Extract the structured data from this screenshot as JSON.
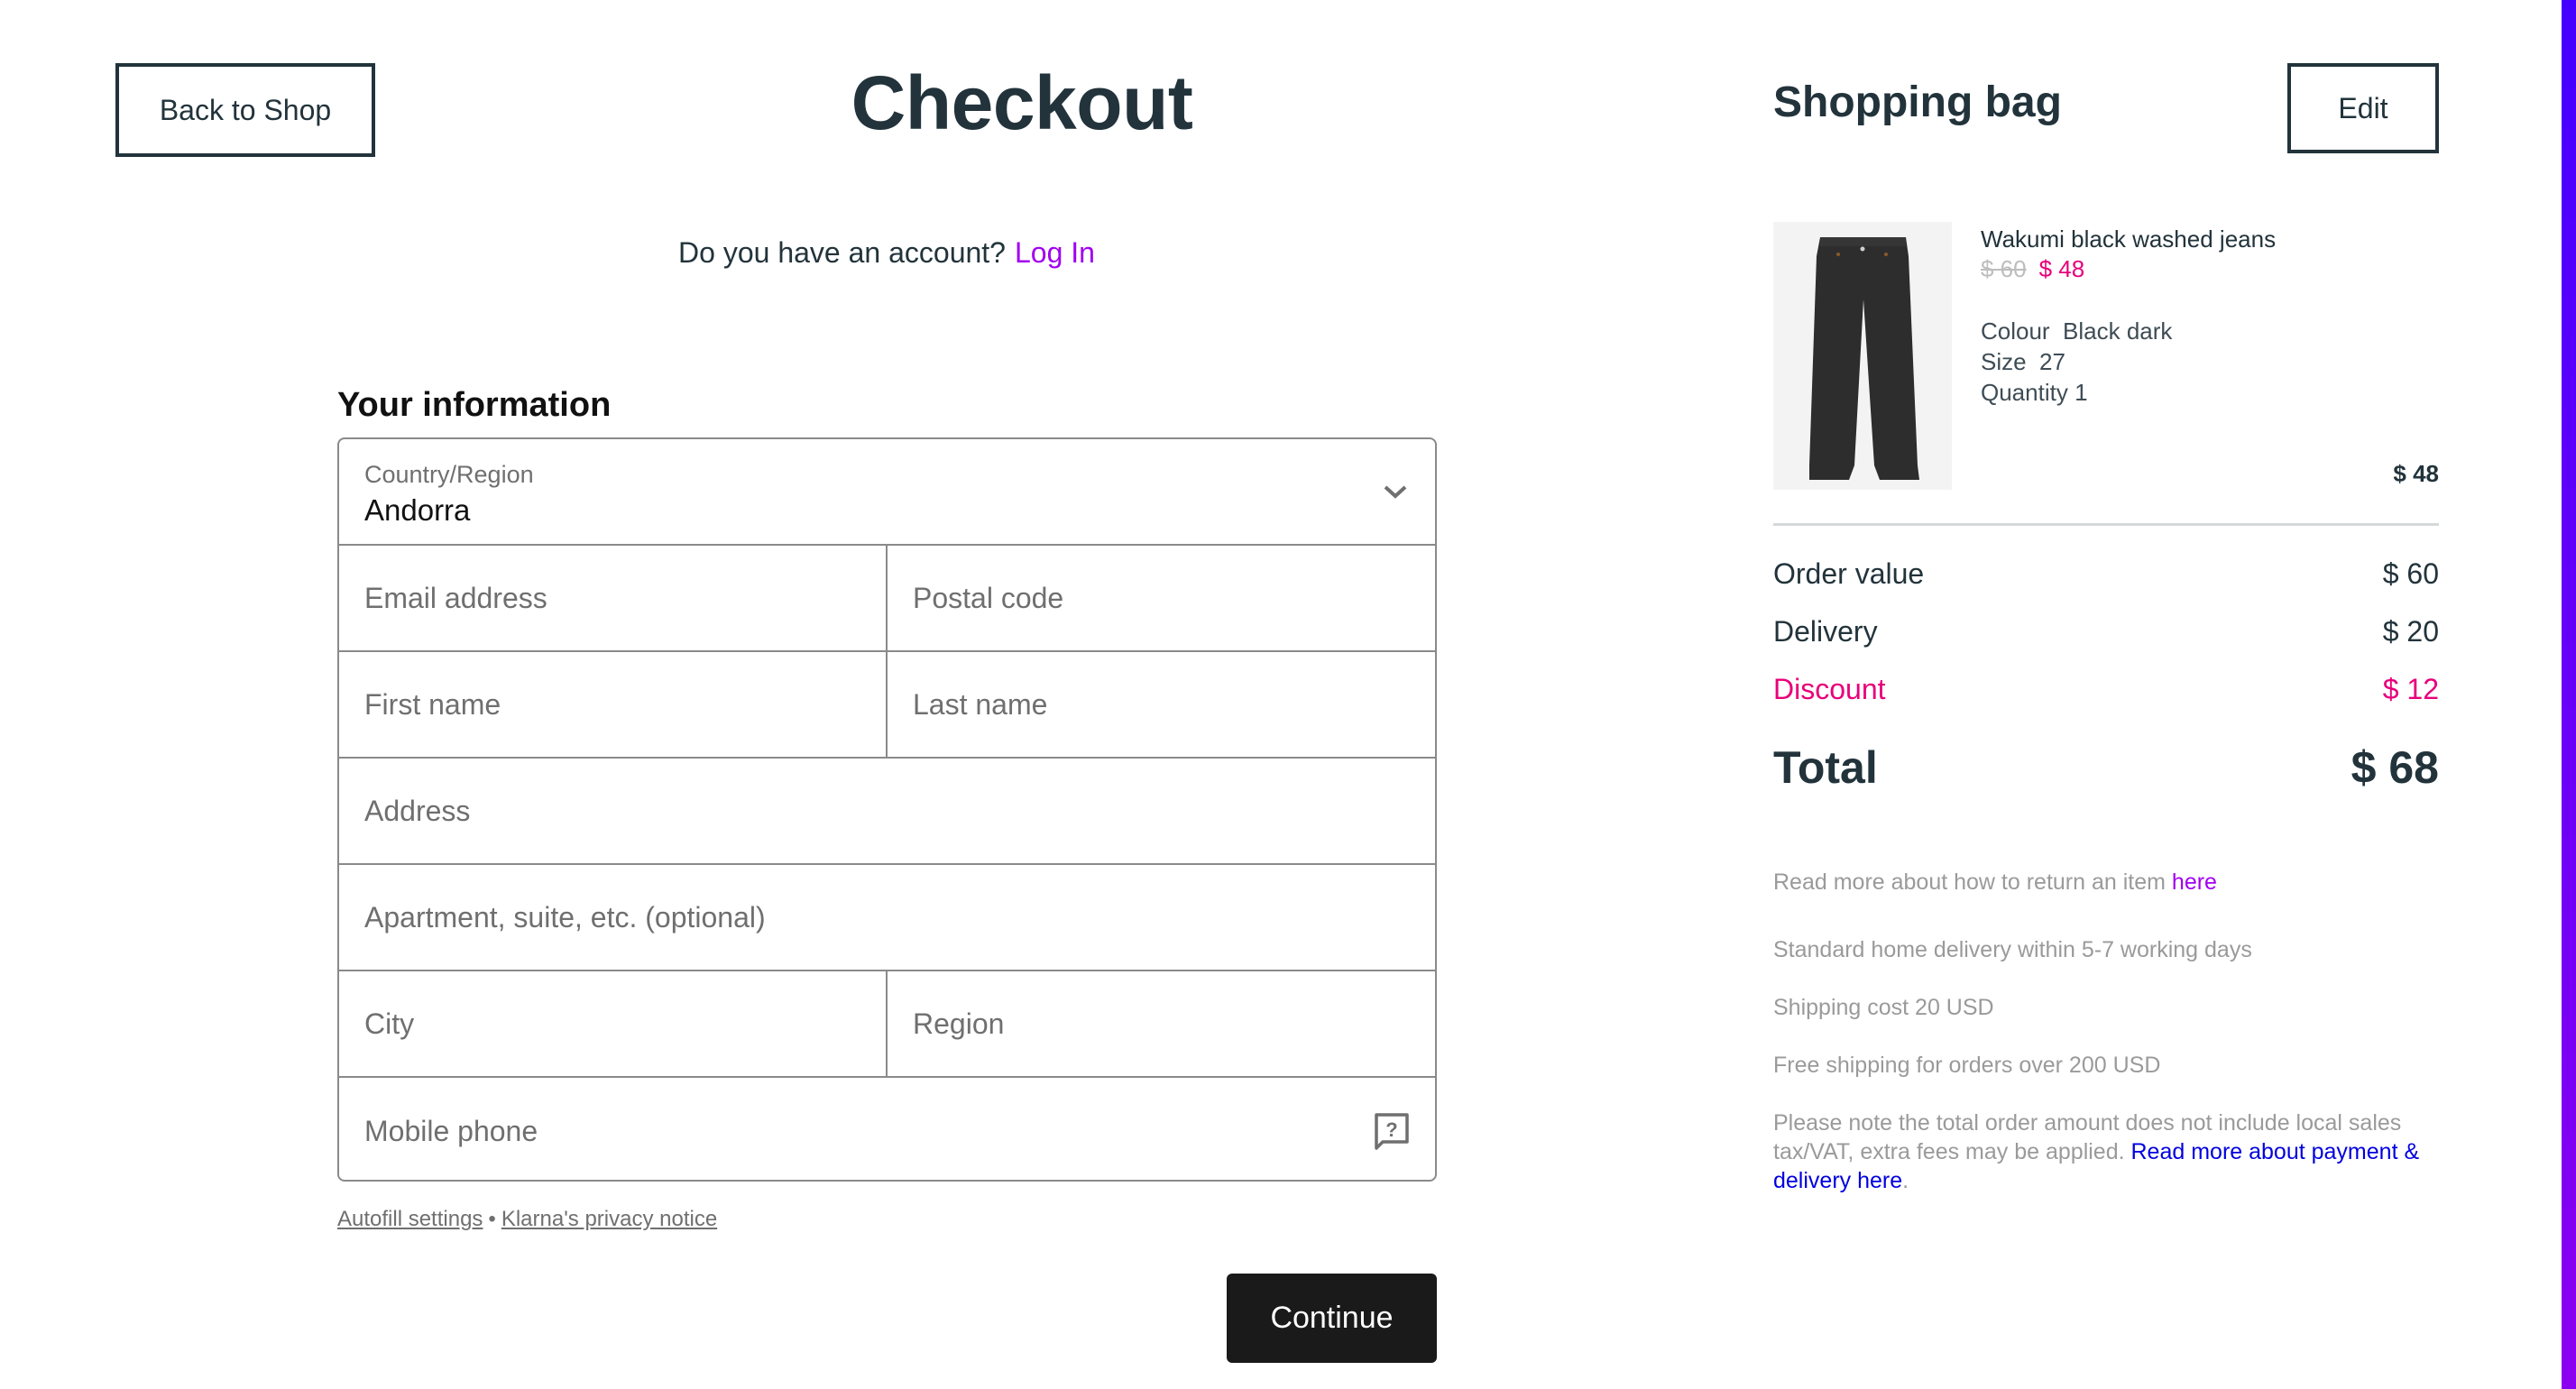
{
  "header": {
    "back_label": "Back to Shop",
    "title": "Checkout",
    "bag_title": "Shopping bag",
    "edit_label": "Edit"
  },
  "login": {
    "prompt": "Do you have an account?",
    "link_label": "Log In"
  },
  "form": {
    "heading": "Your information",
    "country": {
      "label": "Country/Region",
      "value": "Andorra"
    },
    "fields": {
      "email": {
        "placeholder": "Email address",
        "value": ""
      },
      "postal_code": {
        "placeholder": "Postal code",
        "value": ""
      },
      "first_name": {
        "placeholder": "First name",
        "value": ""
      },
      "last_name": {
        "placeholder": "Last name",
        "value": ""
      },
      "address": {
        "placeholder": "Address",
        "value": ""
      },
      "apartment": {
        "placeholder": "Apartment, suite, etc. (optional)",
        "value": ""
      },
      "city": {
        "placeholder": "City",
        "value": ""
      },
      "region": {
        "placeholder": "Region",
        "value": ""
      },
      "mobile_phone": {
        "placeholder": "Mobile phone",
        "value": ""
      }
    },
    "links": {
      "autofill": "Autofill settings",
      "separator": "•",
      "privacy": "Klarna's privacy notice"
    },
    "continue_label": "Continue"
  },
  "bag": {
    "item": {
      "name": "Wakumi black washed jeans",
      "price_original": "$ 60",
      "price_sale": "$ 48",
      "colour_label": "Colour",
      "colour_value": "Black dark",
      "size_label": "Size",
      "size_value": "27",
      "quantity_label": "Quantity",
      "quantity_value": "1",
      "line_total": "$ 48"
    },
    "summary": {
      "order_value_label": "Order value",
      "order_value": "$ 60",
      "delivery_label": "Delivery",
      "delivery": "$ 20",
      "discount_label": "Discount",
      "discount": "$ 12",
      "total_label": "Total",
      "total": "$ 68"
    },
    "info": {
      "return_text": "Read more about how to return an item ",
      "return_link": "here",
      "standard_delivery": "Standard home delivery within 5-7 working days",
      "shipping_cost": "Shipping cost 20 USD",
      "free_shipping": "Free shipping for orders over 200 USD",
      "tax_text": "Please note the total order amount does not include local sales tax/VAT, extra fees may be applied. ",
      "tax_link": "Read more about payment & delivery here",
      "tax_end": "."
    }
  },
  "colors": {
    "text_dark": "#22333b",
    "link_purple": "#a100f0",
    "sale_pink": "#e8007a",
    "link_blue": "#0000e0",
    "button_dark": "#1a1a1a",
    "side_bar_top": "#4400ff",
    "side_bar_bottom": "#8c00f0"
  }
}
